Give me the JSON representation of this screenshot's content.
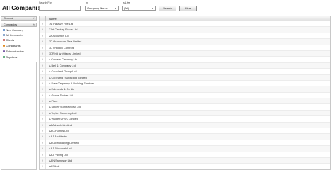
{
  "header": {
    "title": "All Companies",
    "search_for_label": "Search For",
    "search_for_value": "",
    "in_label": "In",
    "in_value": "Company Name",
    "is_live_label": "Is Live",
    "is_live_value": "(All)",
    "search_button": "Search",
    "clear_button": "Clear"
  },
  "sidebar": {
    "general_label": "General",
    "companies_label": "Companies",
    "items": [
      {
        "label": "New Company",
        "icon": "new-company-icon",
        "color": "#4a7fc1"
      },
      {
        "label": "All Companies",
        "icon": "companies-icon",
        "color": "#6a8fbf"
      },
      {
        "label": "Clients",
        "icon": "client-icon",
        "color": "#c0504d"
      },
      {
        "label": "Consultants",
        "icon": "consultant-icon",
        "color": "#e08a1e"
      },
      {
        "label": "Subcontractors",
        "icon": "subcontractor-icon",
        "color": "#7a5aa6"
      },
      {
        "label": "Suppliers",
        "icon": "supplier-icon",
        "color": "#3c9a5f"
      }
    ]
  },
  "grid": {
    "column_name": "Name",
    "rows": [
      "1st Passive Fire Ltd",
      "21st Century Floors Ltd",
      "2A Acoustics Ltd",
      "3D Aluminium Plas Limited",
      "3D Window Controls",
      "3DReid Architects Limited",
      "4 Corners Cleaning Ltd",
      "A Bell & Company Ltd",
      "A Copeland Group Ltd",
      "A Copeland (Surfacing) Limited",
      "A Dale Carpentry & Building Services",
      "A Edmonds & Co Ltd",
      "A Grade Timber Ltd",
      "A Plant",
      "A Spicer (Contractors) Ltd",
      "A Taylor Carpentry Ltd",
      "A Walker UPVC Limited",
      "A&A Lamb Limited",
      "A&C Pumps Ltd",
      "A&J Architects",
      "A&G Bricklaying Limited",
      "A&J Brickwork Ltd",
      "A&J Paving Ltd",
      "A&N Sampson Ltd",
      "A&S Ltd"
    ]
  }
}
